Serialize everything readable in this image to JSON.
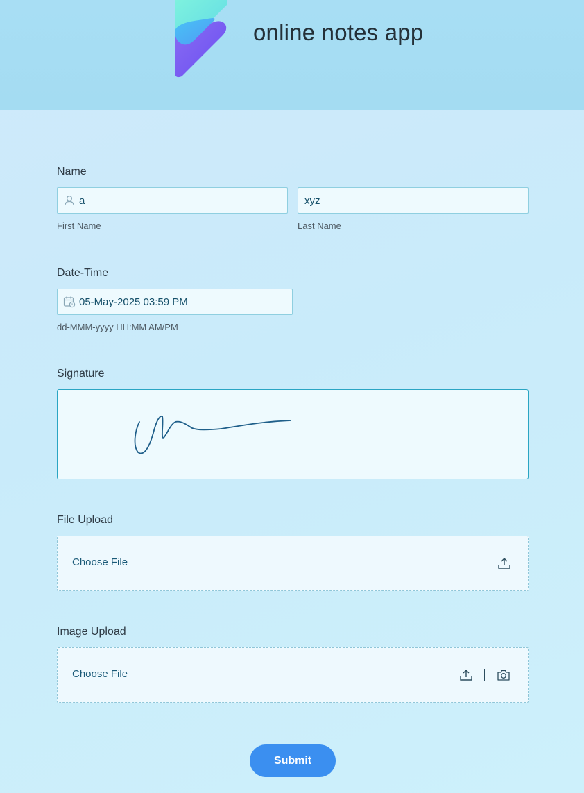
{
  "header": {
    "title": "online notes app"
  },
  "name": {
    "label": "Name",
    "first_value": "a",
    "first_sublabel": "First Name",
    "last_value": "xyz",
    "last_sublabel": "Last Name"
  },
  "datetime": {
    "label": "Date-Time",
    "value": "05-May-2025 03:59 PM",
    "format_hint": "dd-MMM-yyyy HH:MM AM/PM"
  },
  "signature": {
    "label": "Signature"
  },
  "file_upload": {
    "label": "File Upload",
    "choose_label": "Choose File"
  },
  "image_upload": {
    "label": "Image Upload",
    "choose_label": "Choose File"
  },
  "submit": {
    "label": "Submit"
  },
  "colors": {
    "accent": "#3b8ff0",
    "field_border": "#8fcfe0",
    "text_value": "#16506a"
  },
  "icons": [
    "app-logo",
    "user-icon",
    "calendar-clock-icon",
    "upload-icon",
    "camera-icon"
  ]
}
